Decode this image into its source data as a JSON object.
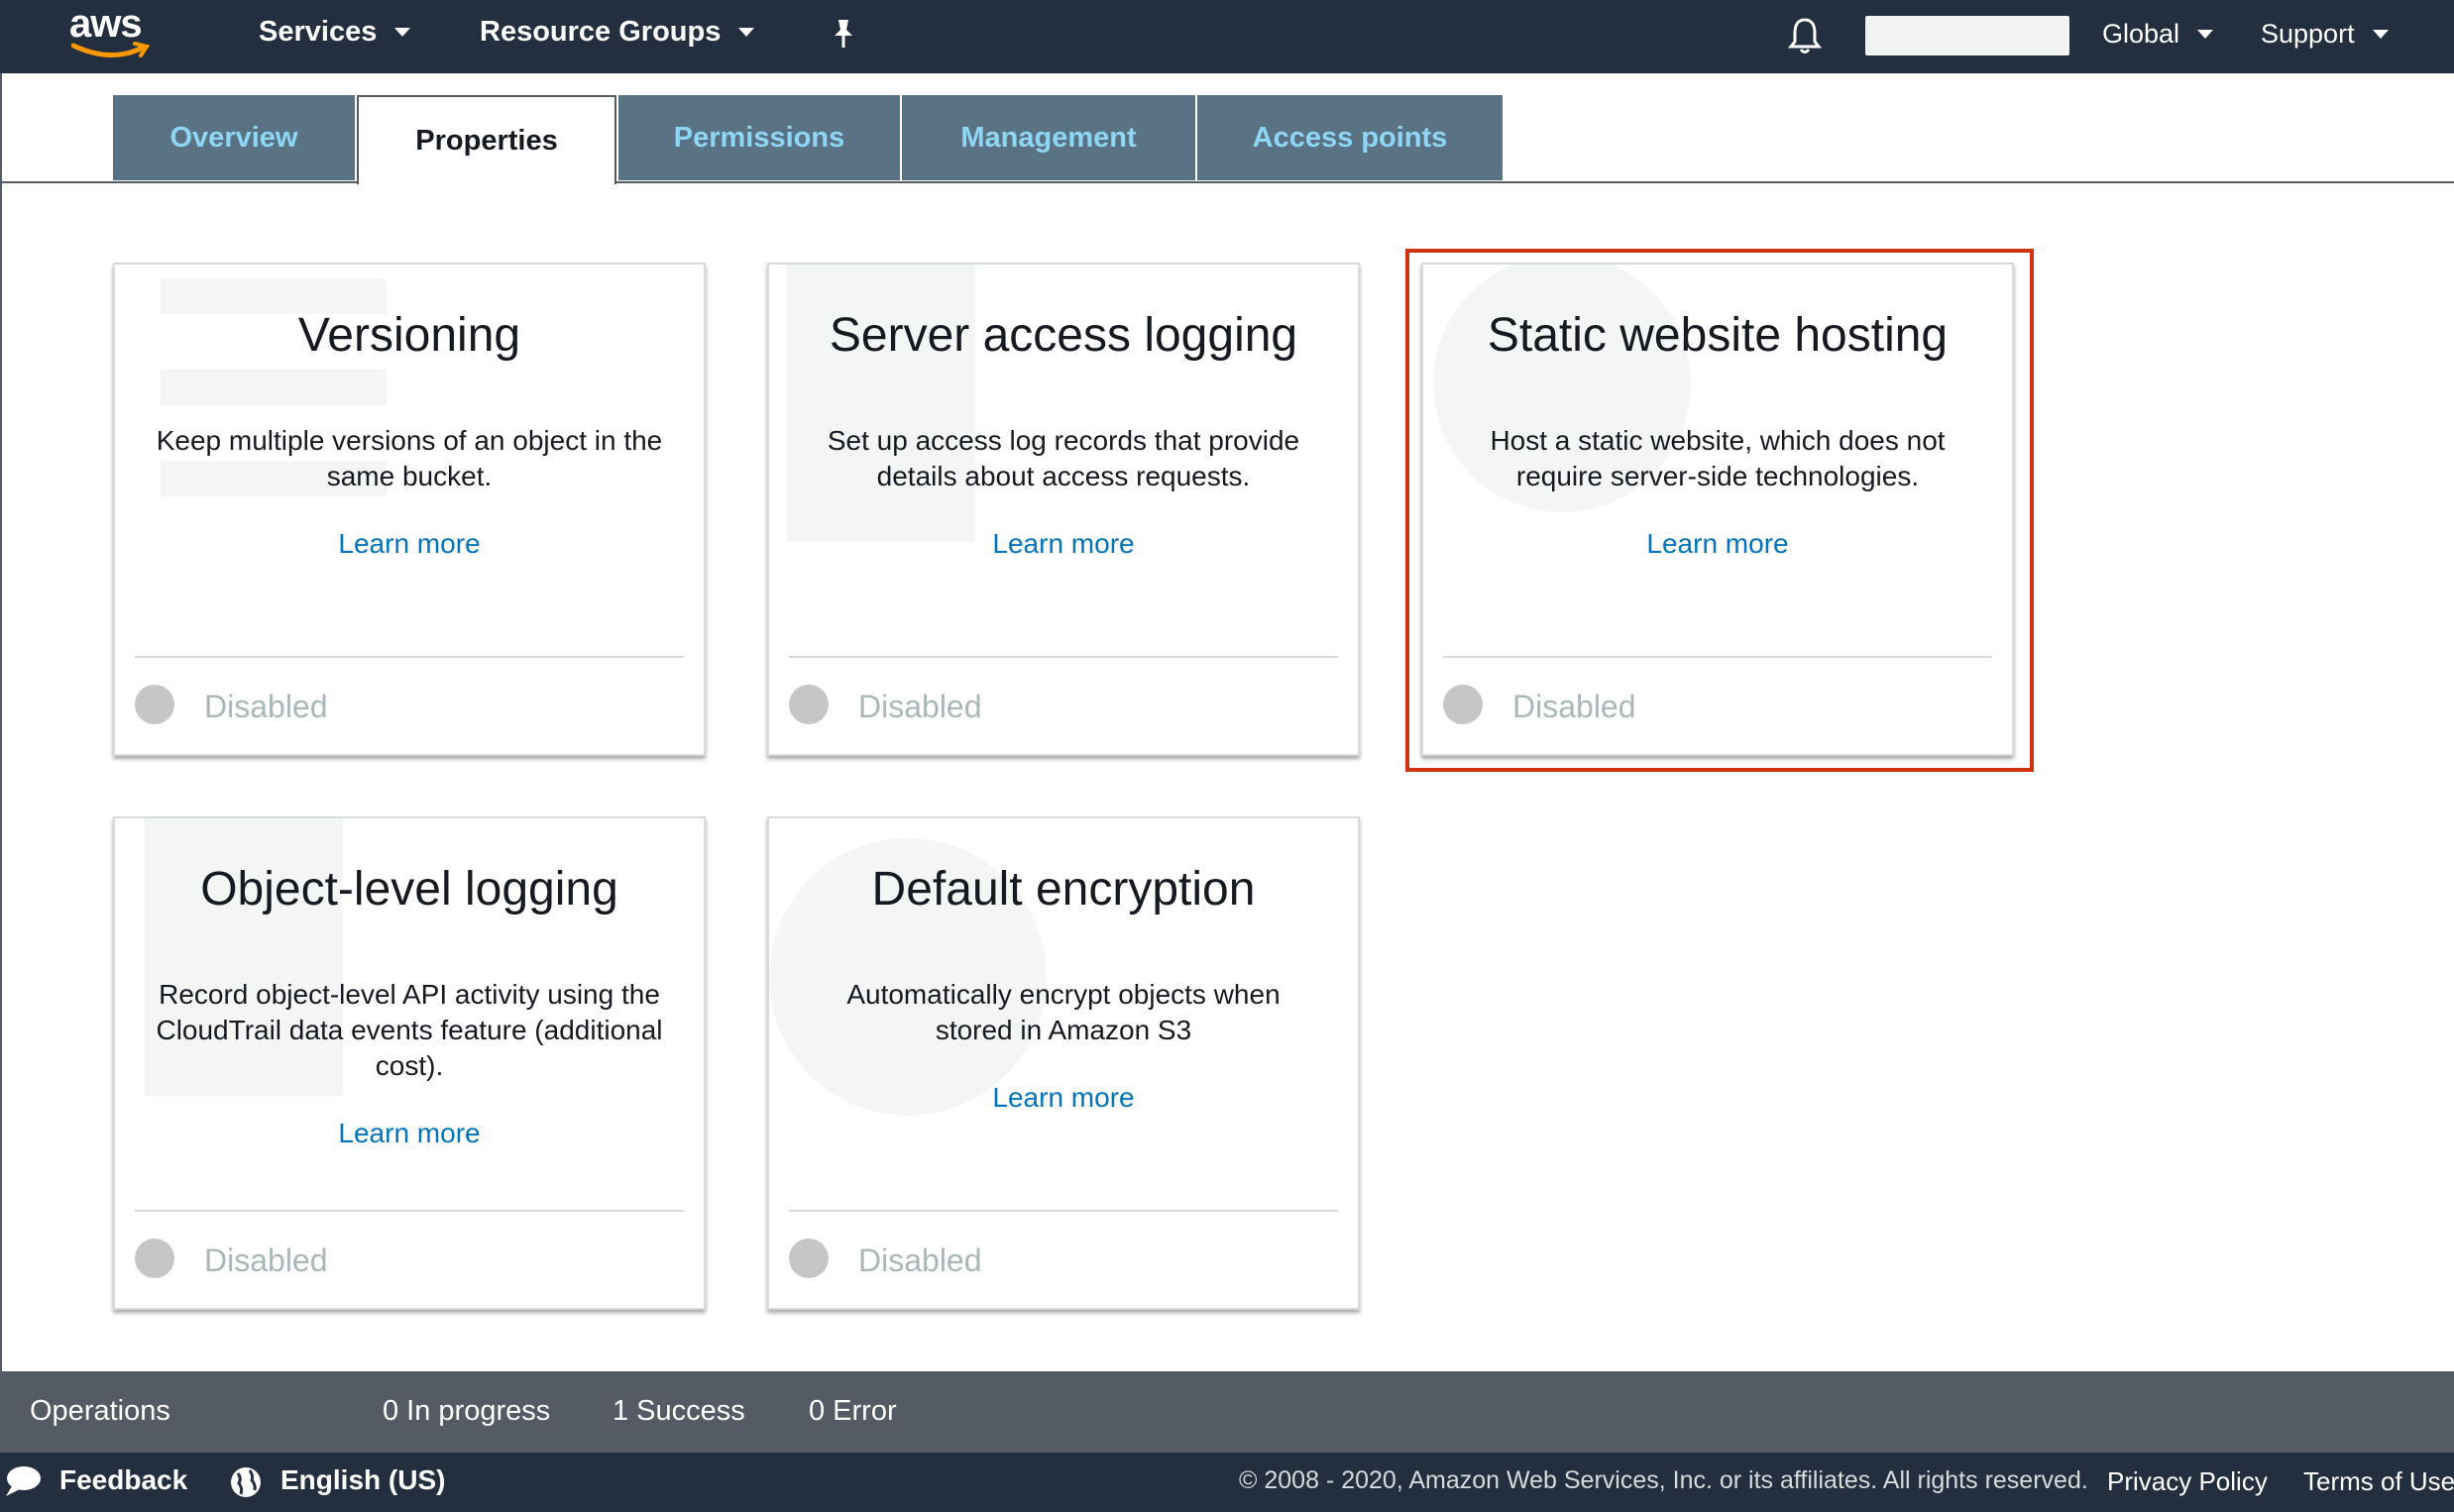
{
  "topnav": {
    "logo_text": "aws",
    "services": "Services",
    "resource_groups": "Resource Groups",
    "region": "Global",
    "support": "Support"
  },
  "tabs": [
    {
      "label": "Overview",
      "active": false
    },
    {
      "label": "Properties",
      "active": true
    },
    {
      "label": "Permissions",
      "active": false
    },
    {
      "label": "Management",
      "active": false
    },
    {
      "label": "Access points",
      "active": false
    }
  ],
  "cards": [
    {
      "title": "Versioning",
      "description": "Keep multiple versions of an object in the same bucket.",
      "learn_more": "Learn more",
      "status": "Disabled"
    },
    {
      "title": "Server access logging",
      "description": "Set up access log records that provide details about access requests.",
      "learn_more": "Learn more",
      "status": "Disabled"
    },
    {
      "title": "Static website hosting",
      "description": "Host a static website, which does not require server-side technologies.",
      "learn_more": "Learn more",
      "status": "Disabled",
      "highlighted": true
    },
    {
      "title": "Object-level logging",
      "description": "Record object-level API activity using the CloudTrail data events feature (additional cost).",
      "learn_more": "Learn more",
      "status": "Disabled"
    },
    {
      "title": "Default encryption",
      "description": "Automatically encrypt objects when stored in Amazon S3",
      "learn_more": "Learn more",
      "status": "Disabled"
    }
  ],
  "operations": {
    "label": "Operations",
    "in_progress": "0 In progress",
    "success": "1 Success",
    "error": "0 Error"
  },
  "footer": {
    "feedback": "Feedback",
    "language": "English (US)",
    "copyright": "© 2008 - 2020, Amazon Web Services, Inc. or its affiliates. All rights reserved.",
    "privacy": "Privacy Policy",
    "terms": "Terms of Use"
  },
  "colors": {
    "nav_bg": "#232f3e",
    "tab_bg": "#5a7384",
    "tab_text": "#8fd5f4",
    "link": "#0073bb",
    "highlight": "#d13212",
    "ops_bg": "#545b64"
  },
  "icons": [
    "aws-logo",
    "chevron-down-icon",
    "pin-icon",
    "bell-icon",
    "speech-bubble-icon",
    "globe-icon"
  ]
}
